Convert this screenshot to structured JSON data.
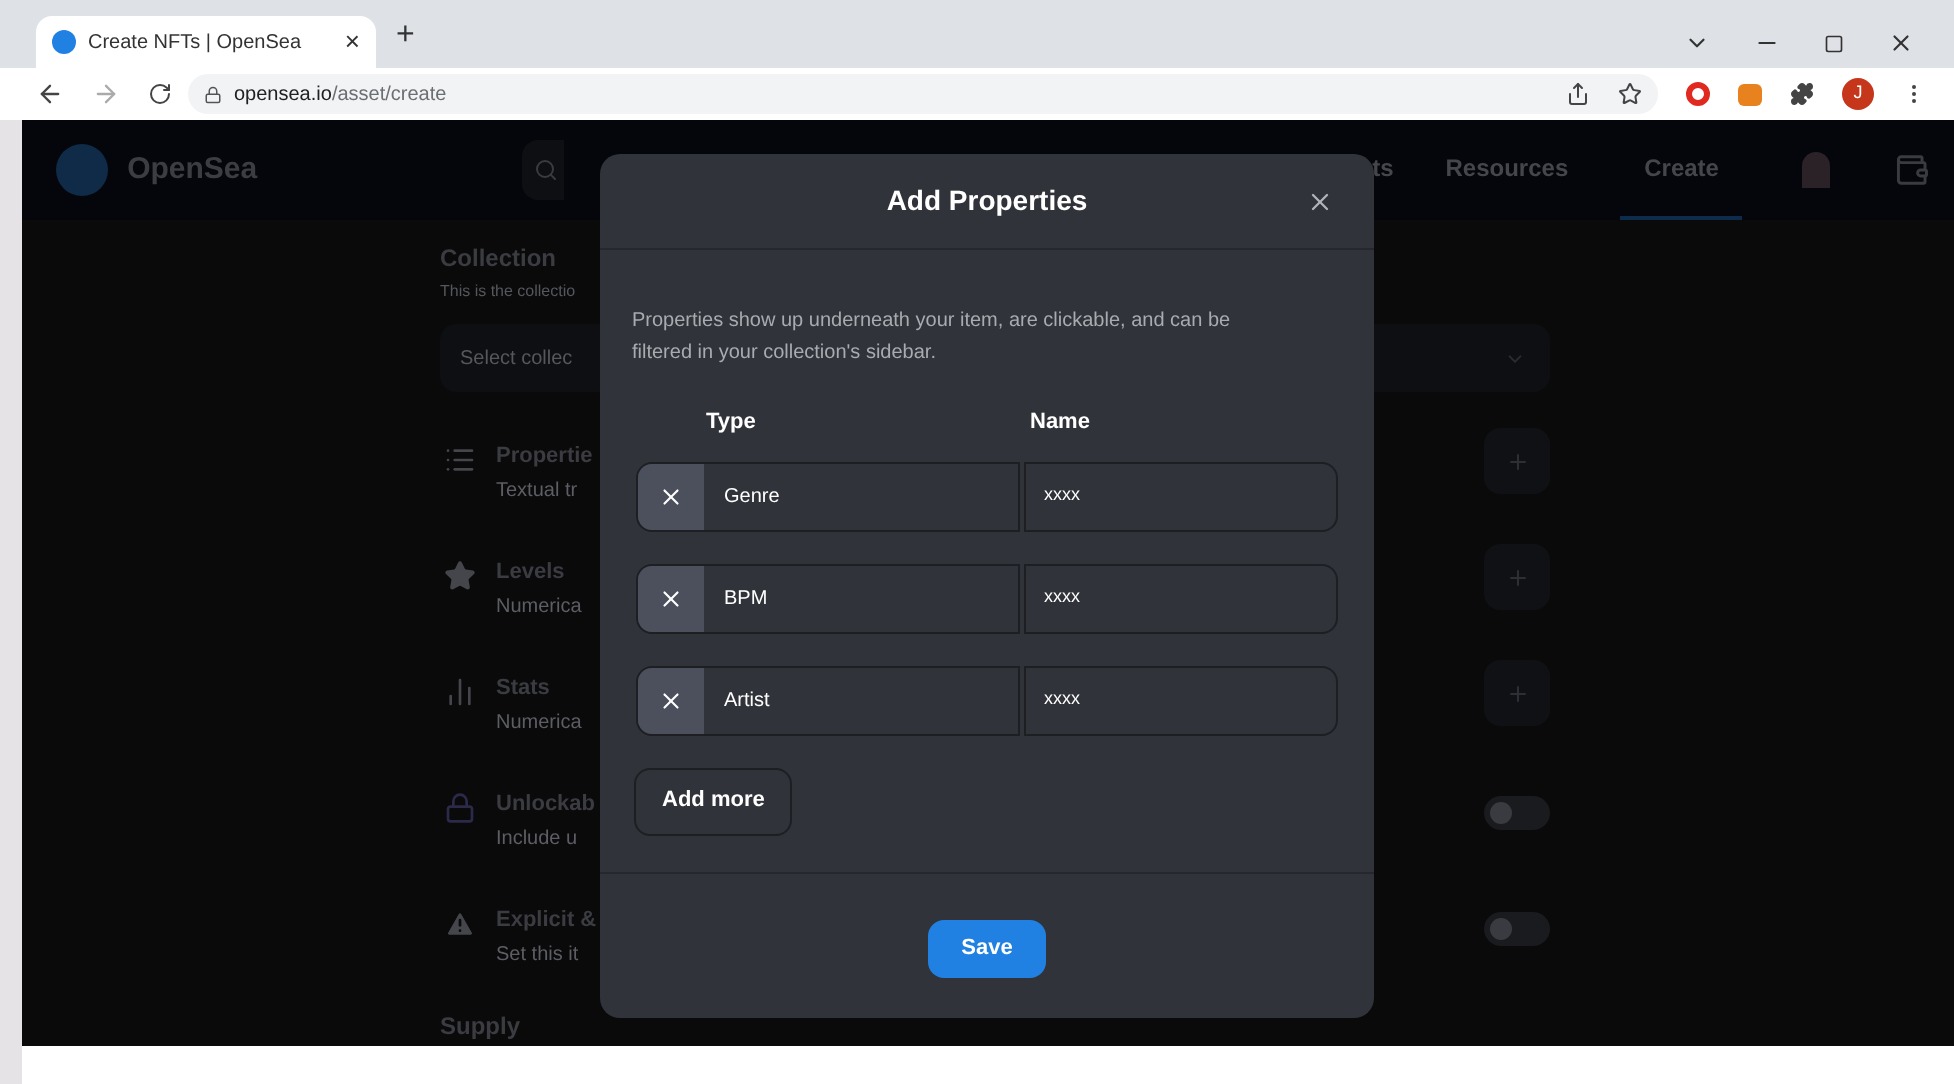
{
  "browser": {
    "tab_title": "Create NFTs | OpenSea",
    "tab_close": "×",
    "new_tab": "+",
    "url_host": "opensea.io",
    "url_path": "/asset/create",
    "profile_initial": "J"
  },
  "header": {
    "logo_text": "OpenSea",
    "nav": [
      {
        "label": "ts",
        "selected": false
      },
      {
        "label": "Resources",
        "selected": false
      },
      {
        "label": "Create",
        "selected": true
      }
    ]
  },
  "form": {
    "collection": {
      "title": "Collection",
      "subtitle": "This is the collectio",
      "placeholder": "Select collec"
    },
    "sections": [
      {
        "kind": "add",
        "title": "Propertie",
        "subtitle": "Textual tr"
      },
      {
        "kind": "add",
        "title": "Levels",
        "subtitle": "Numerica"
      },
      {
        "kind": "add",
        "title": "Stats",
        "subtitle": "Numerica"
      },
      {
        "kind": "toggle",
        "title": "Unlockab",
        "subtitle": "Include u",
        "on": false
      },
      {
        "kind": "toggle",
        "title": "Explicit &",
        "subtitle": "Set this it",
        "on": false
      }
    ],
    "supply_title": "Supply"
  },
  "dialog": {
    "title": "Add Properties",
    "description": "Properties show up underneath your item, are clickable, and can be filtered in your collection's sidebar.",
    "columns": [
      "Type",
      "Name"
    ],
    "rows": [
      {
        "type": "Genre",
        "name": "xxxx"
      },
      {
        "type": "BPM",
        "name": "xxxx"
      },
      {
        "type": "Artist",
        "name": "xxxx"
      }
    ],
    "add_button": "Add more",
    "save_button": "Save"
  }
}
